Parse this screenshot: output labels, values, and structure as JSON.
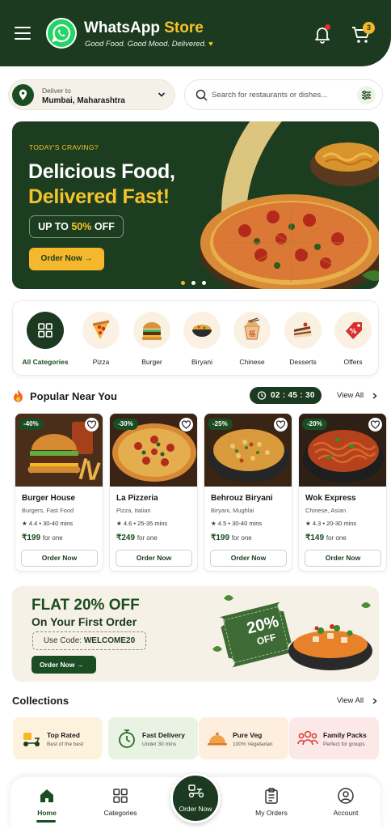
{
  "header": {
    "brand_main": "WhatsApp",
    "brand_accent": "Store",
    "tagline": "Good Food. Good Mood. Delivered.",
    "tagline_icon": "heart-icon",
    "cart_count": "3",
    "colors": {
      "primary": "#1b3a1f",
      "accent": "#f5c22c",
      "whatsapp": "#25d366"
    }
  },
  "location": {
    "label": "Deliver to",
    "value": "Mumbai, Maharashtra"
  },
  "search": {
    "placeholder": "Search for restaurants or dishes..."
  },
  "hero": {
    "kicker": "TODAY'S CRAVING?",
    "title_line1": "Delicious Food,",
    "title_line2": "Delivered Fast!",
    "offer_prefix": "UP TO ",
    "offer_pct": "50%",
    "offer_suffix": " OFF",
    "cta": "Order Now",
    "slide_count": 3,
    "active_slide": 1
  },
  "categories": [
    {
      "label": "All Categories",
      "icon": "grid-icon"
    },
    {
      "label": "Pizza",
      "icon": "pizza-icon"
    },
    {
      "label": "Burger",
      "icon": "burger-icon"
    },
    {
      "label": "Biryani",
      "icon": "biryani-icon"
    },
    {
      "label": "Chinese",
      "icon": "chinese-box-icon"
    },
    {
      "label": "Desserts",
      "icon": "cake-icon"
    },
    {
      "label": "Offers",
      "icon": "offer-tag-icon"
    }
  ],
  "popular": {
    "title": "Popular Near You",
    "timer": "02 : 45 : 30",
    "view_all": "View All",
    "items": [
      {
        "discount": "-40%",
        "name": "Burger House",
        "cuisine": "Burgers, Fast Food",
        "rating": "4.4",
        "time": "30-40 mins",
        "price": "₹199",
        "unit": "for one",
        "cta": "Order Now"
      },
      {
        "discount": "-30%",
        "name": "La Pizzeria",
        "cuisine": "Pizza, Italian",
        "rating": "4.6",
        "time": "25-35 mins",
        "price": "₹249",
        "unit": "for one",
        "cta": "Order Now"
      },
      {
        "discount": "-25%",
        "name": "Behrouz Biryani",
        "cuisine": "Biryani, Mughlai",
        "rating": "4.5",
        "time": "30-40 mins",
        "price": "₹199",
        "unit": "for one",
        "cta": "Order Now"
      },
      {
        "discount": "-20%",
        "name": "Wok Express",
        "cuisine": "Chinese, Asian",
        "rating": "4.3",
        "time": "20-30 mins",
        "price": "₹149",
        "unit": "for one",
        "cta": "Order Now"
      }
    ]
  },
  "promo": {
    "title": "FLAT 20% OFF",
    "subtitle": "On Your First Order",
    "code_label": "Use Code: ",
    "code": "WELCOME20",
    "cta": "Order Now",
    "coupon_line1": "20%",
    "coupon_line2": "OFF"
  },
  "collections": {
    "title": "Collections",
    "view_all": "View All",
    "items": [
      {
        "title": "Top Rated",
        "subtitle": "Best of the best",
        "icon": "scooter-icon",
        "bg": "#fdf3dd"
      },
      {
        "title": "Fast Delivery",
        "subtitle": "Under 30 mins",
        "icon": "stopwatch-icon",
        "bg": "#e9f3e4"
      },
      {
        "title": "Pure Veg",
        "subtitle": "100% Vegetarian",
        "icon": "cloche-icon",
        "bg": "#fdeede"
      },
      {
        "title": "Family Packs",
        "subtitle": "Perfect for groups",
        "icon": "group-icon",
        "bg": "#fde8e8"
      }
    ]
  },
  "bottom_nav": {
    "items": [
      {
        "label": "Home",
        "icon": "home-icon",
        "active": true
      },
      {
        "label": "Categories",
        "icon": "grid-icon"
      },
      {
        "label": "Order Now",
        "icon": "delivery-scooter-icon"
      },
      {
        "label": "My Orders",
        "icon": "clipboard-icon"
      },
      {
        "label": "Account",
        "icon": "user-icon"
      }
    ]
  }
}
